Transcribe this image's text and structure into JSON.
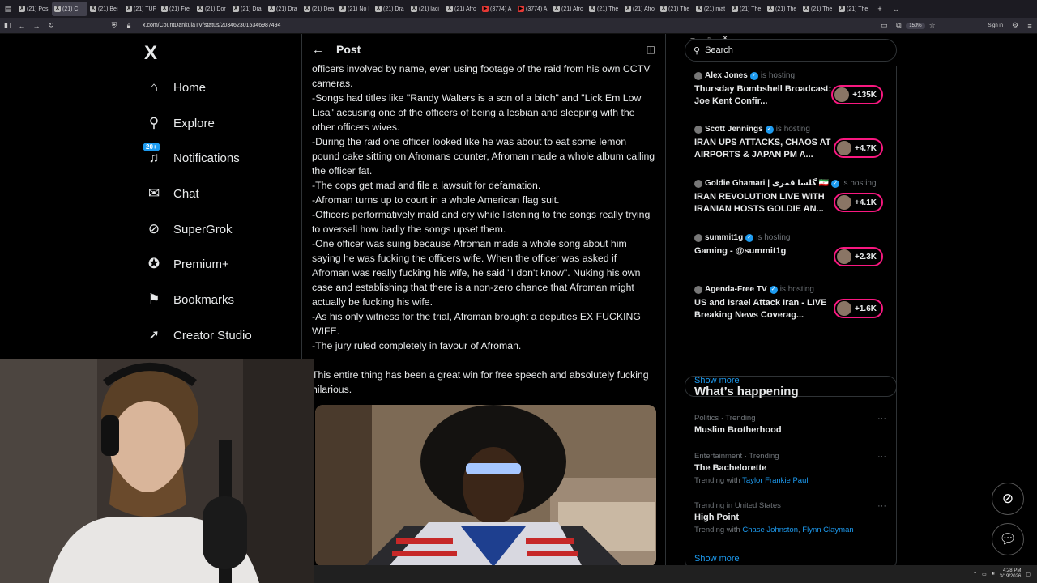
{
  "browser": {
    "tabs": [
      {
        "label": "(21) Pos",
        "active": false
      },
      {
        "label": "(21) C",
        "active": true
      },
      {
        "label": "(21) Bei",
        "active": false
      },
      {
        "label": "(21) TUF",
        "active": false
      },
      {
        "label": "(21) Fre",
        "active": false
      },
      {
        "label": "(21) Dor",
        "active": false
      },
      {
        "label": "(21) Dra",
        "active": false
      },
      {
        "label": "(21) Dra",
        "active": false
      },
      {
        "label": "(21) Dea",
        "active": false
      },
      {
        "label": "(21) No I",
        "active": false
      },
      {
        "label": "(21) Dra",
        "active": false
      },
      {
        "label": "(21) laci",
        "active": false
      },
      {
        "label": "(21) Afro",
        "active": false
      },
      {
        "label": "(3774) A",
        "active": false
      },
      {
        "label": "(3774) A",
        "active": false
      },
      {
        "label": "(21) Afro",
        "active": false
      },
      {
        "label": "(21) The",
        "active": false
      },
      {
        "label": "(21) Afro",
        "active": false
      },
      {
        "label": "(21) The",
        "active": false
      },
      {
        "label": "(21) mat",
        "active": false
      },
      {
        "label": "(21) The",
        "active": false
      },
      {
        "label": "(21) The",
        "active": false
      },
      {
        "label": "(21) The",
        "active": false
      },
      {
        "label": "(21) The",
        "active": false
      }
    ],
    "url": "x.com/CountDankulaTV/status/2034623015346987494",
    "zoom": "150%",
    "signin": "Sign in"
  },
  "nav": {
    "logo": "X",
    "items": [
      {
        "label": "Home",
        "icon": "home-icon",
        "glyph": "⌂"
      },
      {
        "label": "Explore",
        "icon": "search-icon",
        "glyph": "⚲"
      },
      {
        "label": "Notifications",
        "icon": "bell-icon",
        "glyph": "♫",
        "badge": "20+"
      },
      {
        "label": "Chat",
        "icon": "mail-icon",
        "glyph": "✉"
      },
      {
        "label": "SuperGrok",
        "icon": "grok-icon",
        "glyph": "⊘"
      },
      {
        "label": "Premium+",
        "icon": "verified-icon",
        "glyph": "✪"
      },
      {
        "label": "Bookmarks",
        "icon": "bookmark-icon",
        "glyph": "⚑"
      },
      {
        "label": "Creator Studio",
        "icon": "rocket-icon",
        "glyph": "➚"
      }
    ]
  },
  "post": {
    "header": "Post",
    "lines": [
      "officers involved by name, even using footage of the raid from his own CCTV cameras.",
      "-Songs had titles like \"Randy Walters is a son of a bitch\" and \"Lick Em Low Lisa\" accusing one of the officers of being a lesbian and sleeping with the other officers wives.",
      "-During the raid one officer looked like he was about to eat some lemon pound cake sitting on Afromans counter, Afroman made a whole album calling the officer fat.",
      "-The cops get mad and file a lawsuit for defamation.",
      "-Afroman turns up to court in a whole American flag suit.",
      "-Officers performatively mald and cry while listening to the songs really trying to oversell how badly the songs upset them.",
      "-One officer was suing because Afroman made a whole song about him saying he was fucking the officers wife. When the officer was asked if Afroman was really fucking his wife, he said \"I don't know\". Nuking his own case and establishing that there is a non-zero chance that Afroman might actually be fucking his wife.",
      "-As his only witness for the trial, Afroman brought a deputies EX FUCKING WIFE.",
      "-The jury ruled completely in favour of Afroman."
    ],
    "closing": "This entire thing has been a great win for free speech and absolutely fucking hilarious."
  },
  "search": {
    "placeholder": "Search"
  },
  "spaces": [
    {
      "host": "Alex Jones",
      "hosting": "is hosting",
      "title": "Thursday Bombshell Broadcast: Joe Kent Confir...",
      "count": "+135K"
    },
    {
      "host": "Scott Jennings",
      "hosting": "is hosting",
      "title": "IRAN UPS ATTACKS, CHAOS AT AIRPORTS & JAPAN PM A...",
      "count": "+4.7K"
    },
    {
      "host": "Goldie Ghamari | گلسا قمری 🇮🇷",
      "hosting": "is hosting",
      "title": "IRAN REVOLUTION LIVE WITH IRANIAN HOSTS GOLDIE AN...",
      "count": "+4.1K"
    },
    {
      "host": "summit1g",
      "hosting": "is hosting",
      "title": "Gaming - @summit1g",
      "count": "+2.3K"
    },
    {
      "host": "Agenda-Free TV",
      "hosting": "is hosting",
      "title": "US and Israel Attack Iran - LIVE Breaking News Coverag...",
      "count": "+1.6K"
    }
  ],
  "spaces_show_more": "Show more",
  "happening": {
    "title": "What’s happening",
    "trends": [
      {
        "meta": "Politics · Trending",
        "name": "Muslim Brotherhood",
        "with_label": "",
        "with": []
      },
      {
        "meta": "Entertainment · Trending",
        "name": "The Bachelorette",
        "with_label": "Trending with",
        "with": [
          "Taylor Frankie Paul"
        ]
      },
      {
        "meta": "Trending in United States",
        "name": "High Point",
        "with_label": "Trending with",
        "with": [
          "Chase Johnston",
          "Flynn Clayman"
        ]
      }
    ],
    "show_more": "Show more"
  },
  "taskbar": {
    "time": "4:28 PM",
    "date": "3/19/2026"
  }
}
